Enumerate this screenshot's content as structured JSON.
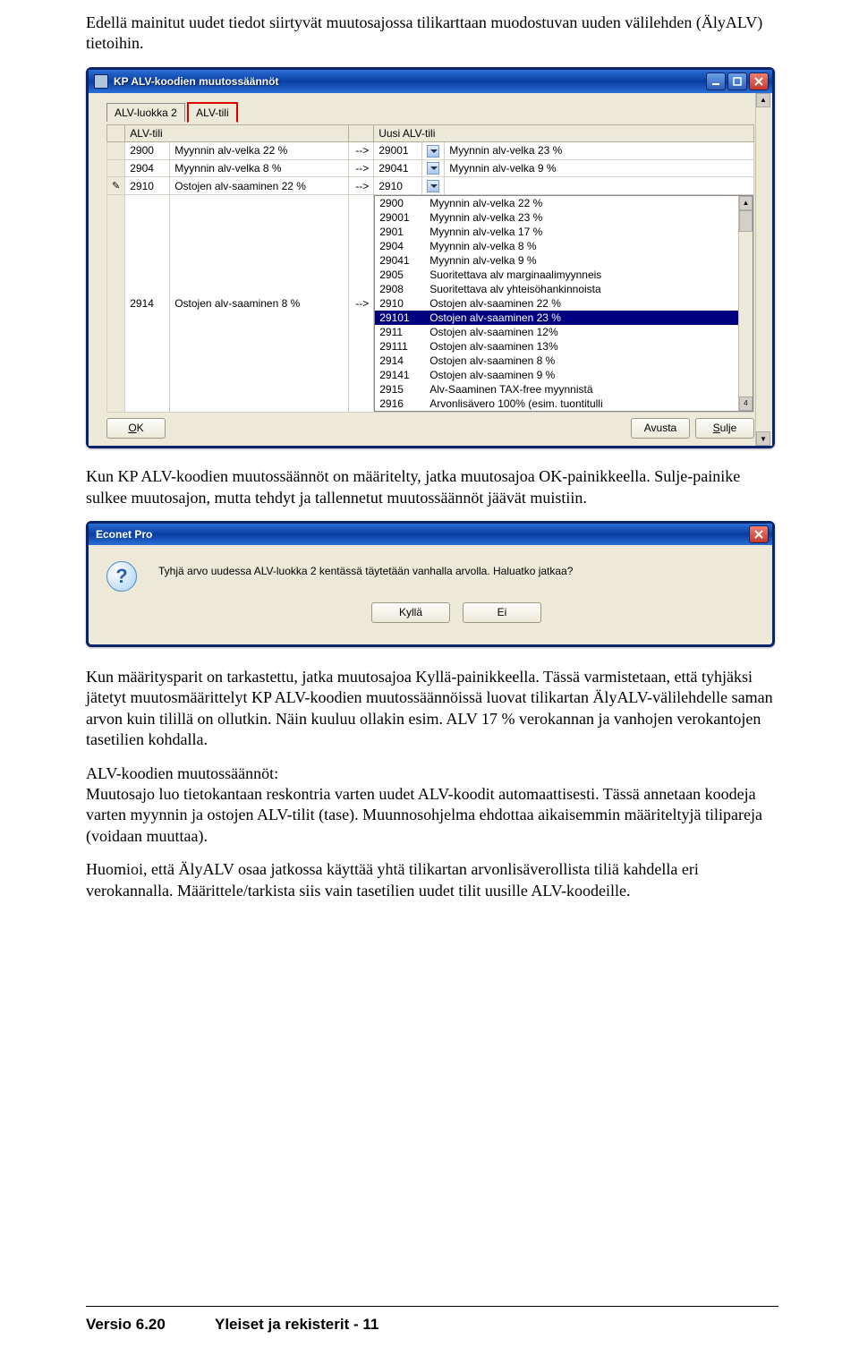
{
  "intro_text": "Edellä mainitut uudet tiedot siirtyvät muutosajossa tilikarttaan muodostuvan uuden välilehden (ÄlyALV) tietoihin.",
  "win1": {
    "title": "KP ALV-koodien muutossäännöt",
    "tabs": {
      "t0": "ALV-luokka 2",
      "t1": "ALV-tili"
    },
    "headers": {
      "h0": "ALV-tili",
      "h1": "",
      "h2": "",
      "h3": "Uusi ALV-tili",
      "h4": ""
    },
    "rows": [
      {
        "rowmark": "",
        "c0": "2900",
        "c1": "Myynnin alv-velka 22 %",
        "c2": "-->",
        "c3": "29001",
        "c4dd": true,
        "c5": "Myynnin alv-velka 23 %"
      },
      {
        "rowmark": "",
        "c0": "2904",
        "c1": "Myynnin alv-velka 8 %",
        "c2": "-->",
        "c3": "29041",
        "c4dd": true,
        "c5": "Myynnin alv-velka 9 %"
      },
      {
        "rowmark": "✎",
        "c0": "2910",
        "c1": "Ostojen alv-saaminen 22 %",
        "c2": "-->",
        "c3": "2910",
        "c4dd": true,
        "c5": ""
      },
      {
        "rowmark": "",
        "c0": "2914",
        "c1": "Ostojen alv-saaminen 8 %",
        "c2": "-->",
        "c3": "",
        "combo": true
      }
    ],
    "combo": [
      {
        "code": "2900",
        "name": "Myynnin alv-velka 22 %"
      },
      {
        "code": "29001",
        "name": "Myynnin alv-velka 23 %"
      },
      {
        "code": "2901",
        "name": "Myynnin alv-velka 17 %"
      },
      {
        "code": "2904",
        "name": "Myynnin alv-velka 8 %"
      },
      {
        "code": "29041",
        "name": "Myynnin alv-velka 9 %"
      },
      {
        "code": "2905",
        "name": "Suoritettava alv marginaalimyynneis"
      },
      {
        "code": "2908",
        "name": "Suoritettava alv yhteisöhankinnoista"
      },
      {
        "code": "2910",
        "name": "Ostojen alv-saaminen 22 %"
      },
      {
        "code": "29101",
        "name": "Ostojen alv-saaminen 23 %",
        "selected": true
      },
      {
        "code": "2911",
        "name": "Ostojen alv-saaminen  12%"
      },
      {
        "code": "29111",
        "name": "Ostojen alv-saaminen  13%"
      },
      {
        "code": "2914",
        "name": "Ostojen alv-saaminen 8 %"
      },
      {
        "code": "29141",
        "name": "Ostojen alv-saaminen 9 %"
      },
      {
        "code": "2915",
        "name": "Alv-Saaminen TAX-free myynnistä"
      },
      {
        "code": "2916",
        "name": "Arvonlisävero 100% (esim. tuontitulli"
      }
    ],
    "corner_badge": "4",
    "buttons": {
      "ok": "OK",
      "avusta": "Avusta",
      "sulje": "Sulje"
    }
  },
  "para2": "Kun KP ALV-koodien muutossäännöt on määritelty, jatka muutosajoa OK-painikkeella. Sulje-painike sulkee muutosajon, mutta tehdyt ja tallennetut muutossäännöt jäävät muistiin.",
  "win2": {
    "title": "Econet Pro",
    "message": "Tyhjä arvo uudessa ALV-luokka 2 kentässä täytetään vanhalla arvolla. Haluatko jatkaa?",
    "buttons": {
      "yes": "Kyllä",
      "no": "Ei"
    }
  },
  "para3": "Kun määritysparit on tarkastettu, jatka muutosajoa Kyllä-painikkeella. Tässä varmistetaan, että tyhjäksi jätetyt muutosmäärittelyt KP ALV-koodien muutossäännöissä luovat tilikartan ÄlyALV-välilehdelle saman arvon kuin tilillä on ollutkin. Näin kuuluu ollakin esim. ALV 17 % verokannan ja vanhojen verokantojen tasetilien kohdalla.",
  "para4": "ALV-koodien muutossäännöt:\nMuutosajo luo tietokantaan reskontria varten uudet ALV-koodit automaattisesti. Tässä annetaan koodeja varten myynnin ja ostojen ALV-tilit (tase). Muunnosohjelma ehdottaa aikaisemmin määriteltyjä tilipareja (voidaan muuttaa).",
  "para5": "Huomioi, että ÄlyALV osaa jatkossa käyttää yhtä tilikartan arvonlisäverollista tiliä kahdella eri verokannalla. Määrittele/tarkista siis vain tasetilien uudet tilit uusille ALV-koodeille.",
  "footer": {
    "version": "Versio 6.20",
    "section": "Yleiset ja rekisterit - 11"
  }
}
